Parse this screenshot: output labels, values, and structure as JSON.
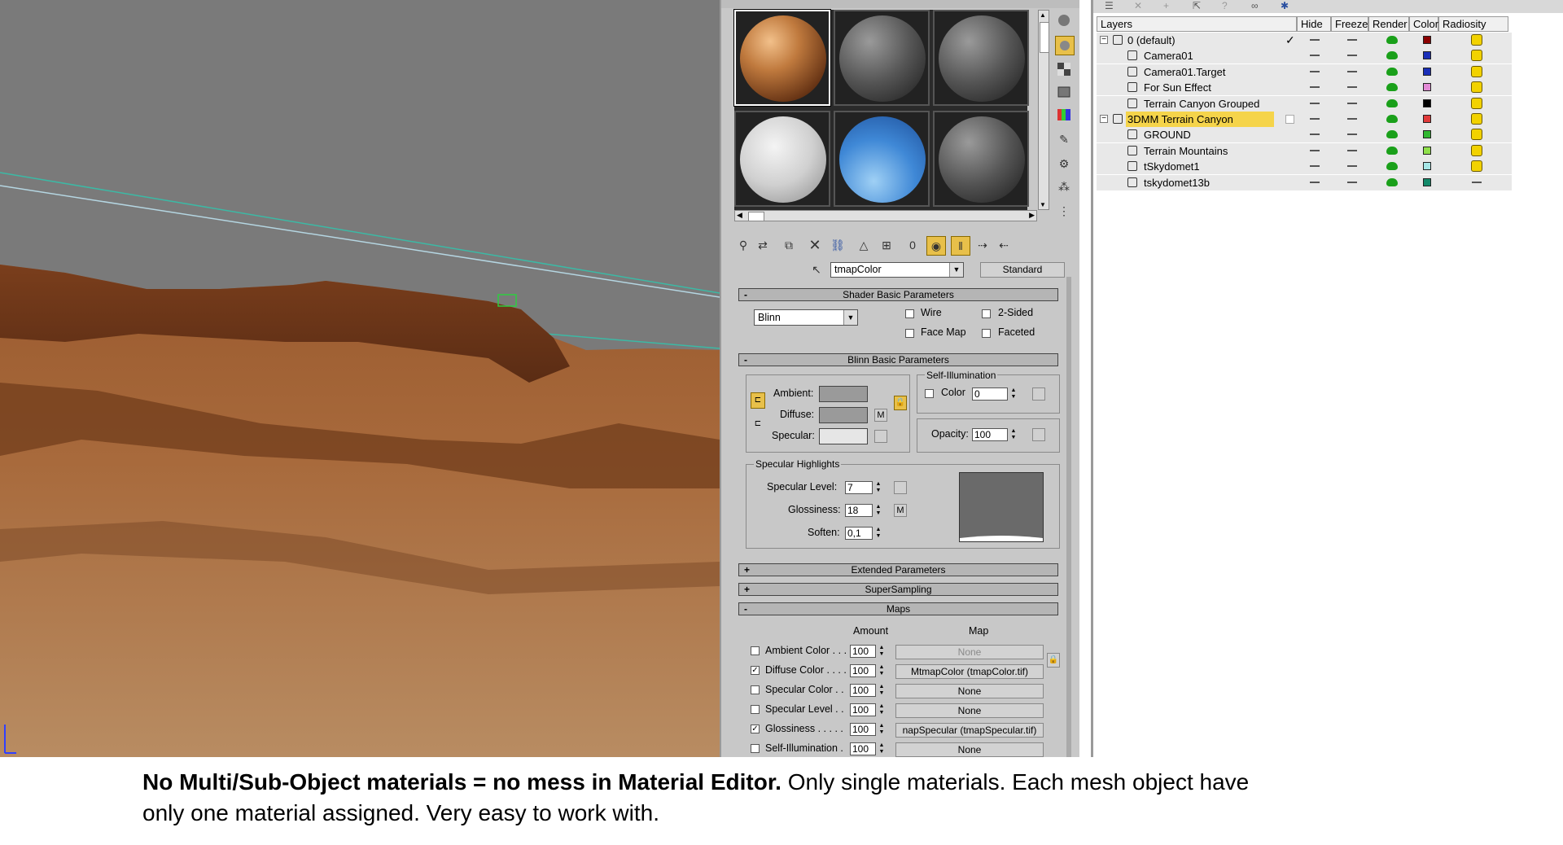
{
  "material_editor": {
    "material_name": "tmapColor",
    "material_type": "Standard",
    "shader_basic": {
      "title": "Shader Basic Parameters",
      "shader": "Blinn",
      "wire": "Wire",
      "two_sided": "2-Sided",
      "face_map": "Face Map",
      "faceted": "Faceted"
    },
    "blinn_basic": {
      "title": "Blinn Basic Parameters",
      "ambient": "Ambient:",
      "diffuse": "Diffuse:",
      "specular": "Specular:",
      "m_label": "M",
      "self_illum_title": "Self-Illumination",
      "color_label": "Color",
      "color_value": "0",
      "opacity_label": "Opacity:",
      "opacity_value": "100"
    },
    "specular_highlights": {
      "title": "Specular Highlights",
      "level_label": "Specular Level:",
      "level_value": "7",
      "gloss_label": "Glossiness:",
      "gloss_value": "18",
      "soften_label": "Soften:",
      "soften_value": "0,1",
      "m_label": "M"
    },
    "extended": "Extended Parameters",
    "supersampling": "SuperSampling",
    "maps": {
      "title": "Maps",
      "amount_header": "Amount",
      "map_header": "Map",
      "rows": [
        {
          "label": "Ambient Color . . .",
          "amount": "100",
          "map": "None",
          "checked": false,
          "dim": true
        },
        {
          "label": "Diffuse Color . . . .",
          "amount": "100",
          "map": "MtmapColor (tmapColor.tif)",
          "checked": true,
          "dim": false
        },
        {
          "label": "Specular Color . .",
          "amount": "100",
          "map": "None",
          "checked": false,
          "dim": false
        },
        {
          "label": "Specular Level . .",
          "amount": "100",
          "map": "None",
          "checked": false,
          "dim": false
        },
        {
          "label": "Glossiness . . . . .",
          "amount": "100",
          "map": "napSpecular (tmapSpecular.tif)",
          "checked": true,
          "dim": false
        },
        {
          "label": "Self-Illumination .",
          "amount": "100",
          "map": "None",
          "checked": false,
          "dim": false
        }
      ]
    }
  },
  "layers": {
    "headers": {
      "layers": "Layers",
      "hide": "Hide",
      "freeze": "Freeze",
      "render": "Render",
      "color": "Color",
      "radiosity": "Radiosity"
    },
    "rows": [
      {
        "name": "0 (default)",
        "type": "layer",
        "color": "#8b0000",
        "check": true,
        "selected": false,
        "radiosity": true
      },
      {
        "name": "Camera01",
        "type": "object",
        "color": "#1a2fb8",
        "check": false,
        "selected": false,
        "radiosity": true
      },
      {
        "name": "Camera01.Target",
        "type": "object",
        "color": "#1a2fb8",
        "check": false,
        "selected": false,
        "radiosity": true
      },
      {
        "name": "For Sun Effect",
        "type": "object",
        "color": "#e38ad6",
        "check": false,
        "selected": false,
        "radiosity": true
      },
      {
        "name": "Terrain Canyon Grouped",
        "type": "object",
        "color": "#000000",
        "check": false,
        "selected": false,
        "radiosity": true
      },
      {
        "name": "3DMM Terrain Canyon",
        "type": "layer",
        "color": "#e03a3a",
        "check": false,
        "selected": true,
        "radiosity": true
      },
      {
        "name": "GROUND",
        "type": "object",
        "color": "#32b832",
        "check": false,
        "selected": false,
        "radiosity": true
      },
      {
        "name": "Terrain Mountains",
        "type": "object",
        "color": "#8fe04a",
        "check": false,
        "selected": false,
        "radiosity": true
      },
      {
        "name": "tSkydomet1",
        "type": "object",
        "color": "#a6e6e6",
        "check": false,
        "selected": false,
        "radiosity": true
      },
      {
        "name": "tskydomet13b",
        "type": "object",
        "color": "#138a6a",
        "check": false,
        "selected": false,
        "radiosity": false
      }
    ]
  },
  "caption": {
    "bold": "No Multi/Sub-Object materials = no mess in Material Editor.",
    "normal": " Only single materials. Each mesh object have",
    "line2": "only one material assigned. Very easy to work with."
  }
}
